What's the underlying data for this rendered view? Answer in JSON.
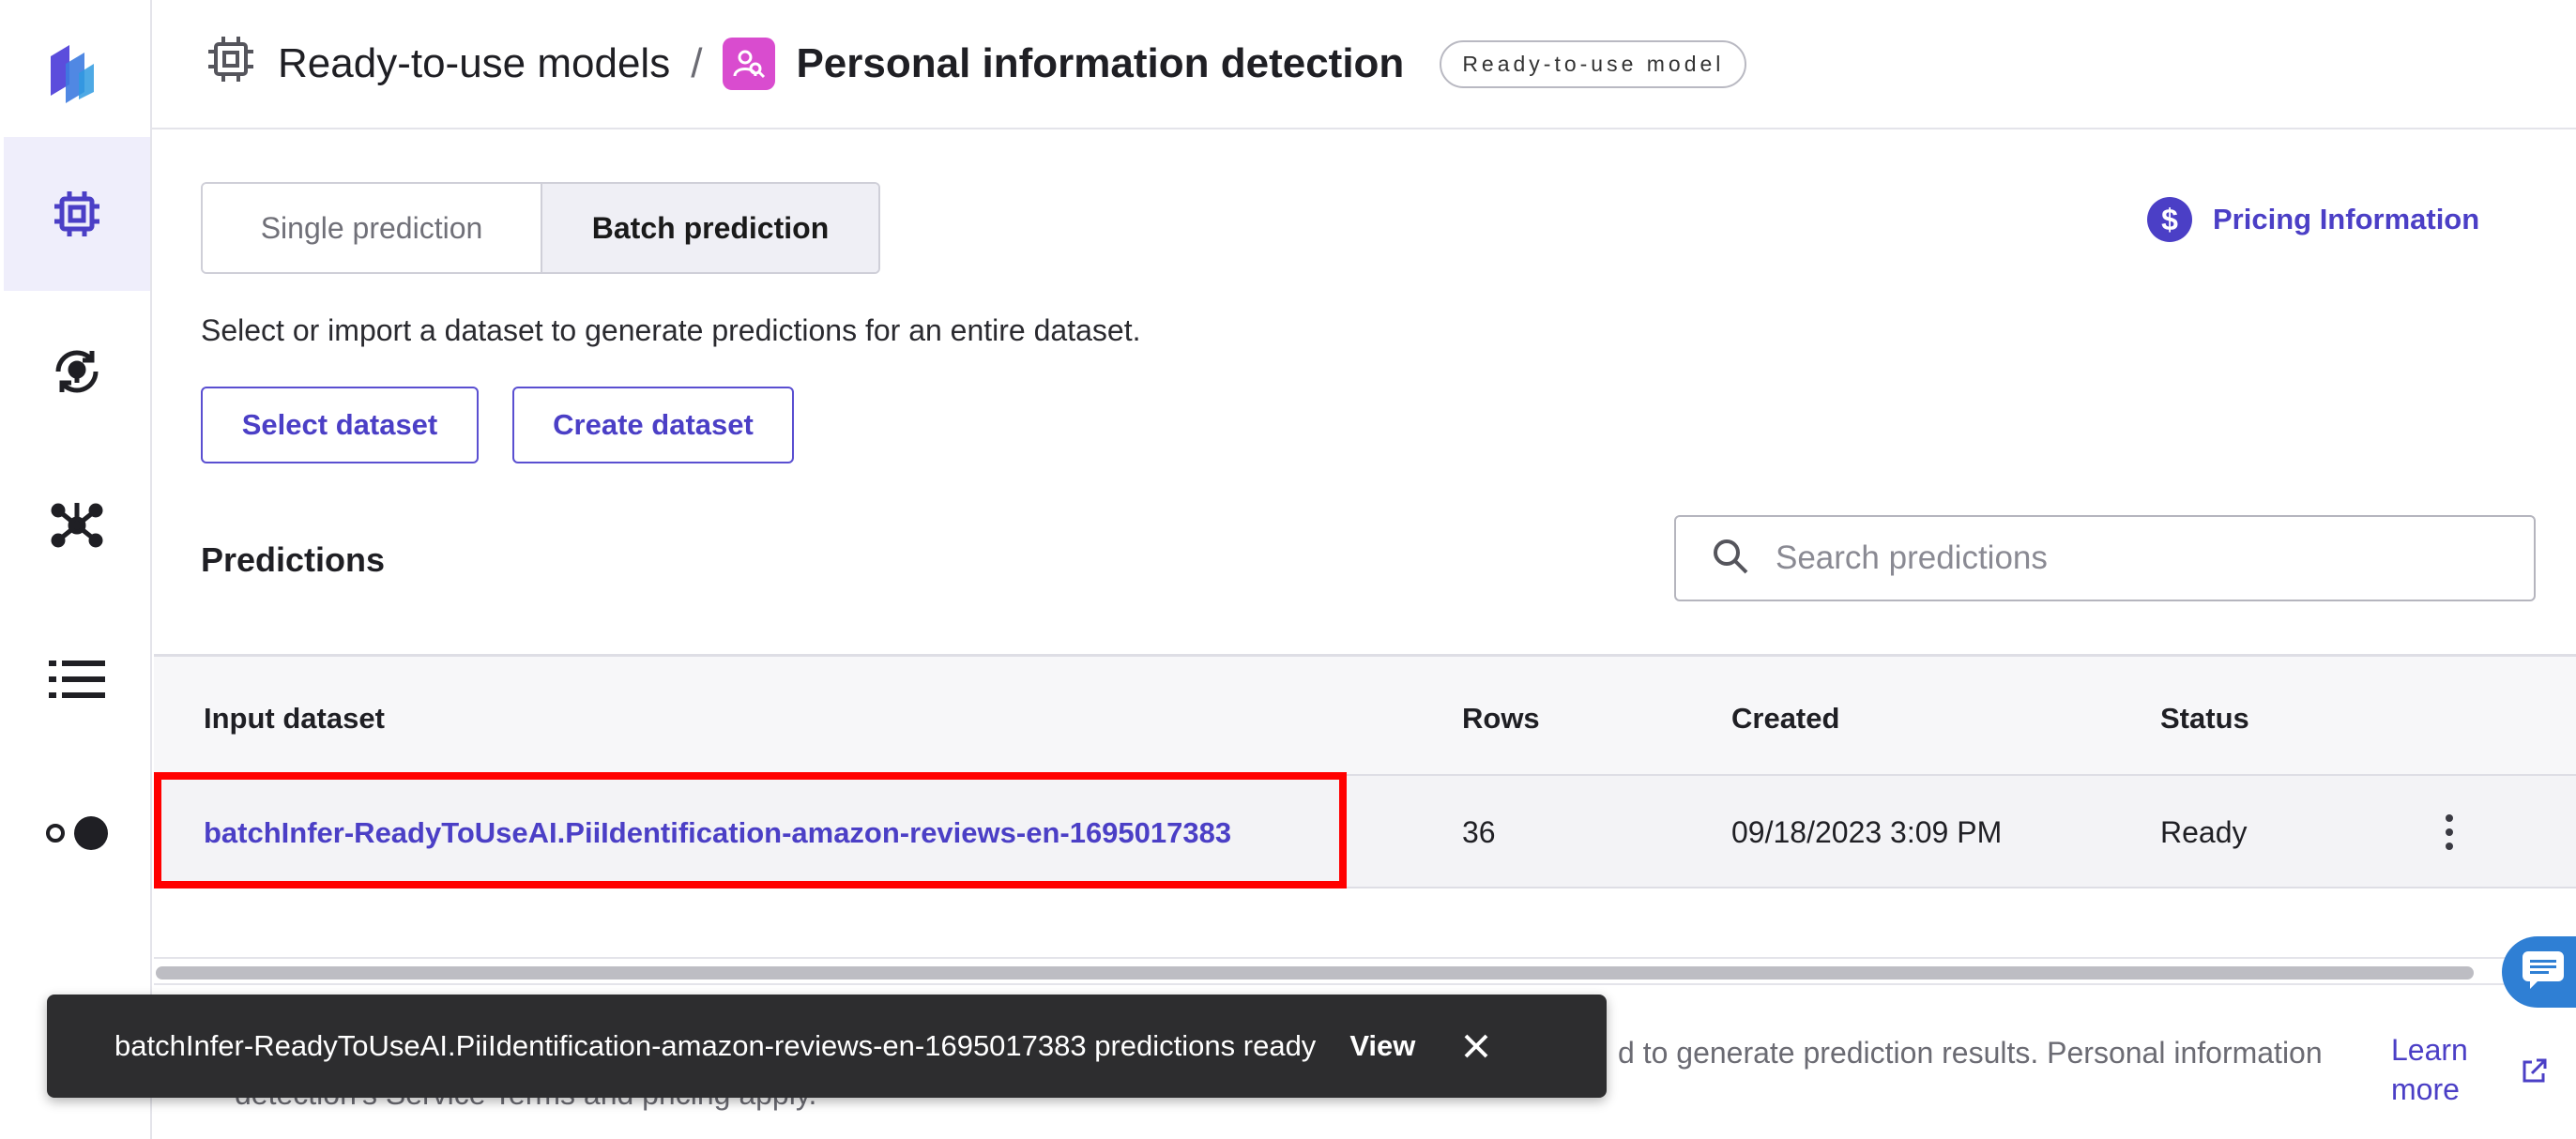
{
  "sidebar": {
    "items": [
      {
        "icon": "logo-icon"
      },
      {
        "icon": "chip-icon",
        "active": true
      },
      {
        "icon": "refresh-bulb-icon"
      },
      {
        "icon": "network-icon"
      },
      {
        "icon": "list-icon"
      },
      {
        "icon": "toggle-icon"
      }
    ]
  },
  "header": {
    "breadcrumb_parent": "Ready-to-use models",
    "separator": "/",
    "title": "Personal information detection",
    "badge": "Ready-to-use model"
  },
  "tabs": [
    {
      "label": "Single prediction"
    },
    {
      "label": "Batch prediction"
    }
  ],
  "pricing": {
    "label": "Pricing Information",
    "icon": "dollar-icon"
  },
  "description": "Select or import a dataset to generate predictions for an entire dataset.",
  "actions": {
    "select_dataset": "Select dataset",
    "create_dataset": "Create dataset"
  },
  "predictions": {
    "title": "Predictions",
    "search_placeholder": "Search predictions",
    "columns": {
      "input_dataset": "Input dataset",
      "rows": "Rows",
      "created": "Created",
      "status": "Status"
    },
    "rows": [
      {
        "input_dataset": "batchInfer-ReadyToUseAI.PiiIdentification-amazon-reviews-en-1695017383",
        "rows": "36",
        "created": "09/18/2023 3:09 PM",
        "status": "Ready"
      }
    ]
  },
  "footer": {
    "line1": "d to generate prediction results. Personal information",
    "line2": "detection's Service Terms and pricing apply.",
    "learn_more_1": "Learn",
    "learn_more_2": "more"
  },
  "toast": {
    "message": "batchInfer-ReadyToUseAI.PiiIdentification-amazon-reviews-en-1695017383 predictions ready",
    "view": "View"
  },
  "colors": {
    "accent": "#4b3fc6",
    "highlight": "#ff0000",
    "toast_bg": "#2d2d2f",
    "pii_icon_bg": "#d94ccf"
  }
}
